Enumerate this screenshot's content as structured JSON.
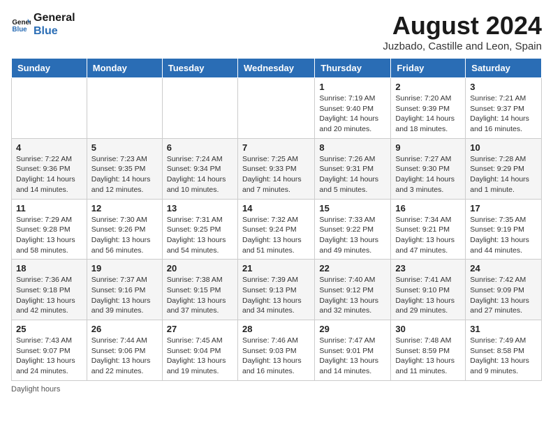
{
  "header": {
    "logo_line1": "General",
    "logo_line2": "Blue",
    "main_title": "August 2024",
    "subtitle": "Juzbado, Castille and Leon, Spain"
  },
  "weekdays": [
    "Sunday",
    "Monday",
    "Tuesday",
    "Wednesday",
    "Thursday",
    "Friday",
    "Saturday"
  ],
  "weeks": [
    [
      {
        "day": "",
        "info": ""
      },
      {
        "day": "",
        "info": ""
      },
      {
        "day": "",
        "info": ""
      },
      {
        "day": "",
        "info": ""
      },
      {
        "day": "1",
        "info": "Sunrise: 7:19 AM\nSunset: 9:40 PM\nDaylight: 14 hours and 20 minutes."
      },
      {
        "day": "2",
        "info": "Sunrise: 7:20 AM\nSunset: 9:39 PM\nDaylight: 14 hours and 18 minutes."
      },
      {
        "day": "3",
        "info": "Sunrise: 7:21 AM\nSunset: 9:37 PM\nDaylight: 14 hours and 16 minutes."
      }
    ],
    [
      {
        "day": "4",
        "info": "Sunrise: 7:22 AM\nSunset: 9:36 PM\nDaylight: 14 hours and 14 minutes."
      },
      {
        "day": "5",
        "info": "Sunrise: 7:23 AM\nSunset: 9:35 PM\nDaylight: 14 hours and 12 minutes."
      },
      {
        "day": "6",
        "info": "Sunrise: 7:24 AM\nSunset: 9:34 PM\nDaylight: 14 hours and 10 minutes."
      },
      {
        "day": "7",
        "info": "Sunrise: 7:25 AM\nSunset: 9:33 PM\nDaylight: 14 hours and 7 minutes."
      },
      {
        "day": "8",
        "info": "Sunrise: 7:26 AM\nSunset: 9:31 PM\nDaylight: 14 hours and 5 minutes."
      },
      {
        "day": "9",
        "info": "Sunrise: 7:27 AM\nSunset: 9:30 PM\nDaylight: 14 hours and 3 minutes."
      },
      {
        "day": "10",
        "info": "Sunrise: 7:28 AM\nSunset: 9:29 PM\nDaylight: 14 hours and 1 minute."
      }
    ],
    [
      {
        "day": "11",
        "info": "Sunrise: 7:29 AM\nSunset: 9:28 PM\nDaylight: 13 hours and 58 minutes."
      },
      {
        "day": "12",
        "info": "Sunrise: 7:30 AM\nSunset: 9:26 PM\nDaylight: 13 hours and 56 minutes."
      },
      {
        "day": "13",
        "info": "Sunrise: 7:31 AM\nSunset: 9:25 PM\nDaylight: 13 hours and 54 minutes."
      },
      {
        "day": "14",
        "info": "Sunrise: 7:32 AM\nSunset: 9:24 PM\nDaylight: 13 hours and 51 minutes."
      },
      {
        "day": "15",
        "info": "Sunrise: 7:33 AM\nSunset: 9:22 PM\nDaylight: 13 hours and 49 minutes."
      },
      {
        "day": "16",
        "info": "Sunrise: 7:34 AM\nSunset: 9:21 PM\nDaylight: 13 hours and 47 minutes."
      },
      {
        "day": "17",
        "info": "Sunrise: 7:35 AM\nSunset: 9:19 PM\nDaylight: 13 hours and 44 minutes."
      }
    ],
    [
      {
        "day": "18",
        "info": "Sunrise: 7:36 AM\nSunset: 9:18 PM\nDaylight: 13 hours and 42 minutes."
      },
      {
        "day": "19",
        "info": "Sunrise: 7:37 AM\nSunset: 9:16 PM\nDaylight: 13 hours and 39 minutes."
      },
      {
        "day": "20",
        "info": "Sunrise: 7:38 AM\nSunset: 9:15 PM\nDaylight: 13 hours and 37 minutes."
      },
      {
        "day": "21",
        "info": "Sunrise: 7:39 AM\nSunset: 9:13 PM\nDaylight: 13 hours and 34 minutes."
      },
      {
        "day": "22",
        "info": "Sunrise: 7:40 AM\nSunset: 9:12 PM\nDaylight: 13 hours and 32 minutes."
      },
      {
        "day": "23",
        "info": "Sunrise: 7:41 AM\nSunset: 9:10 PM\nDaylight: 13 hours and 29 minutes."
      },
      {
        "day": "24",
        "info": "Sunrise: 7:42 AM\nSunset: 9:09 PM\nDaylight: 13 hours and 27 minutes."
      }
    ],
    [
      {
        "day": "25",
        "info": "Sunrise: 7:43 AM\nSunset: 9:07 PM\nDaylight: 13 hours and 24 minutes."
      },
      {
        "day": "26",
        "info": "Sunrise: 7:44 AM\nSunset: 9:06 PM\nDaylight: 13 hours and 22 minutes."
      },
      {
        "day": "27",
        "info": "Sunrise: 7:45 AM\nSunset: 9:04 PM\nDaylight: 13 hours and 19 minutes."
      },
      {
        "day": "28",
        "info": "Sunrise: 7:46 AM\nSunset: 9:03 PM\nDaylight: 13 hours and 16 minutes."
      },
      {
        "day": "29",
        "info": "Sunrise: 7:47 AM\nSunset: 9:01 PM\nDaylight: 13 hours and 14 minutes."
      },
      {
        "day": "30",
        "info": "Sunrise: 7:48 AM\nSunset: 8:59 PM\nDaylight: 13 hours and 11 minutes."
      },
      {
        "day": "31",
        "info": "Sunrise: 7:49 AM\nSunset: 8:58 PM\nDaylight: 13 hours and 9 minutes."
      }
    ]
  ],
  "footer": {
    "daylight_label": "Daylight hours"
  }
}
